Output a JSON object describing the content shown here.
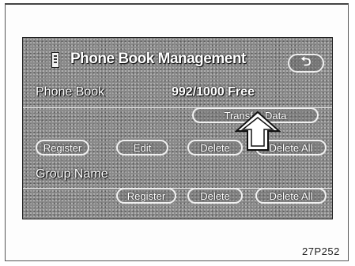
{
  "header": {
    "title": "Phone Book Management",
    "back_glyph": "⮌"
  },
  "phone_book": {
    "label": "Phone Book",
    "count": "992/1000 Free"
  },
  "buttons": {
    "transfer_data": "Transfer Data",
    "register": "Register",
    "edit": "Edit",
    "delete": "Delete",
    "delete_all": "Delete All"
  },
  "group": {
    "label": "Group Name"
  },
  "group_buttons": {
    "register": "Register",
    "delete": "Delete",
    "delete_all": "Delete All"
  },
  "caption": "27P252",
  "icons": [
    "phone-book-icon",
    "back-icon",
    "pointer-arrow-icon"
  ]
}
